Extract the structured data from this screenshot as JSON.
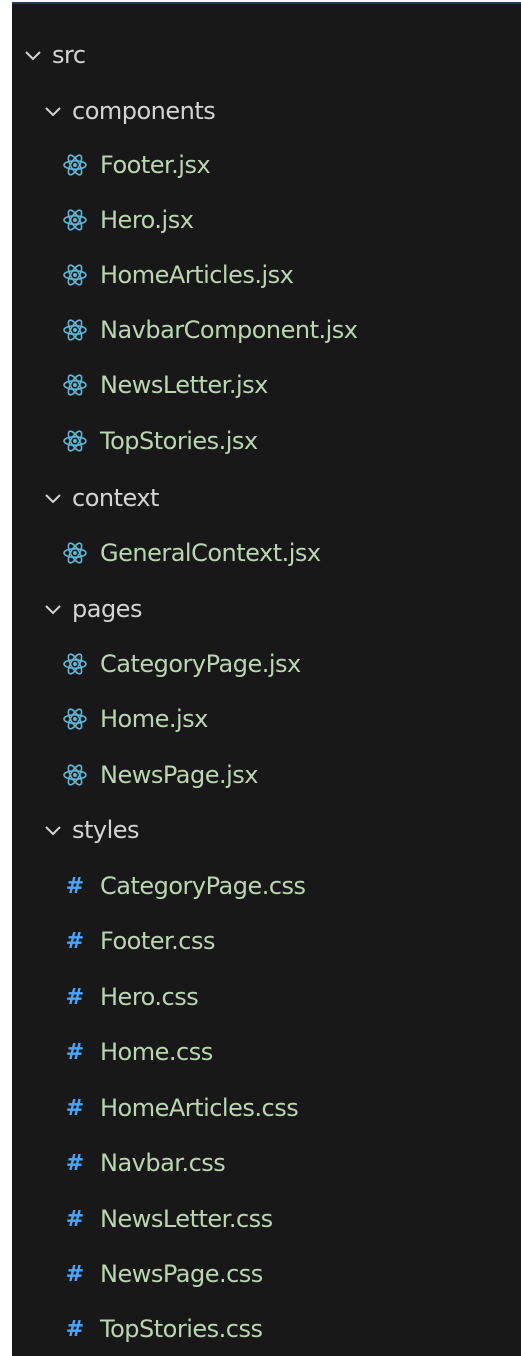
{
  "explorer": {
    "root": {
      "label": "src",
      "chevron_icon": "chevron-down-icon"
    },
    "components": {
      "label": "components",
      "files": [
        {
          "label": "Footer.jsx",
          "icon": "react-icon"
        },
        {
          "label": "Hero.jsx",
          "icon": "react-icon"
        },
        {
          "label": "HomeArticles.jsx",
          "icon": "react-icon"
        },
        {
          "label": "NavbarComponent.jsx",
          "icon": "react-icon"
        },
        {
          "label": "NewsLetter.jsx",
          "icon": "react-icon"
        },
        {
          "label": "TopStories.jsx",
          "icon": "react-icon"
        }
      ]
    },
    "context": {
      "label": "context",
      "files": [
        {
          "label": "GeneralContext.jsx",
          "icon": "react-icon"
        }
      ]
    },
    "pages": {
      "label": "pages",
      "files": [
        {
          "label": "CategoryPage.jsx",
          "icon": "react-icon"
        },
        {
          "label": "Home.jsx",
          "icon": "react-icon"
        },
        {
          "label": "NewsPage.jsx",
          "icon": "react-icon"
        }
      ]
    },
    "styles": {
      "label": "styles",
      "files": [
        {
          "label": "CategoryPage.css",
          "icon": "css-hash-icon"
        },
        {
          "label": "Footer.css",
          "icon": "css-hash-icon"
        },
        {
          "label": "Hero.css",
          "icon": "css-hash-icon"
        },
        {
          "label": "Home.css",
          "icon": "css-hash-icon"
        },
        {
          "label": "HomeArticles.css",
          "icon": "css-hash-icon"
        },
        {
          "label": "Navbar.css",
          "icon": "css-hash-icon"
        },
        {
          "label": "NewsLetter.css",
          "icon": "css-hash-icon"
        },
        {
          "label": "NewsPage.css",
          "icon": "css-hash-icon"
        },
        {
          "label": "TopStories.css",
          "icon": "css-hash-icon"
        }
      ],
      "hash_glyph": "#"
    },
    "colors": {
      "background": "#181818",
      "folder_text": "#d4d4d4",
      "file_text": "#b9d6b0",
      "react_icon": "#5fb8d8",
      "css_icon": "#4aa6ff"
    }
  }
}
